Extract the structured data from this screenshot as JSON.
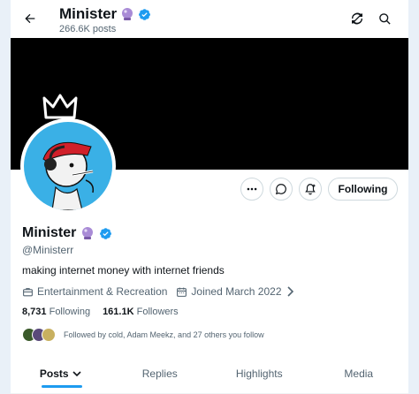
{
  "header": {
    "name": "Minister",
    "posts_count": "266.6K posts"
  },
  "profile": {
    "name": "Minister",
    "handle": "@Ministerr",
    "bio": "making internet money with internet friends",
    "category": "Entertainment & Recreation",
    "joined": "Joined March 2022",
    "following_count": "8,731",
    "following_label": "Following",
    "followers_count": "161.1K",
    "followers_label": "Followers",
    "followed_by": "Followed by cold, Adam Meekz, and 27 others you follow"
  },
  "buttons": {
    "following": "Following"
  },
  "tabs": [
    {
      "label": "Posts"
    },
    {
      "label": "Replies"
    },
    {
      "label": "Highlights"
    },
    {
      "label": "Media"
    }
  ],
  "colors": {
    "accent": "#1d9bf0",
    "verified": "#1d9bf0",
    "banner": "#000000",
    "avatar_bg": "#3ab0e6"
  },
  "icons": [
    "back-arrow-icon",
    "crystal-ball-icon",
    "verified-badge-icon",
    "refresh-icon",
    "search-icon",
    "more-icon",
    "message-icon",
    "notify-icon",
    "briefcase-icon",
    "calendar-icon",
    "chevron-right-icon",
    "chevron-down-icon",
    "crown-icon"
  ]
}
